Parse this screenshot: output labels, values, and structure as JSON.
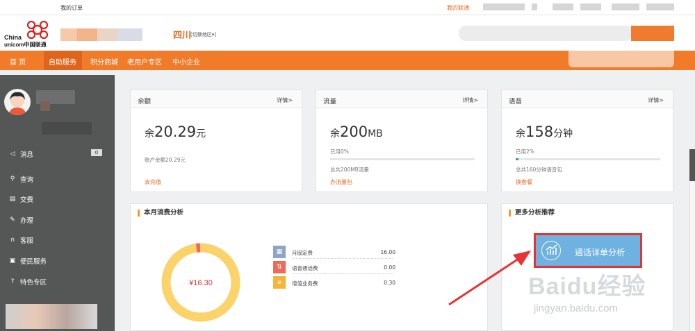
{
  "topbar": {
    "orders": "我的订单",
    "my_unicom": "我的联通"
  },
  "logo": {
    "line1": "China",
    "line2": "unicom中国联通"
  },
  "header": {
    "region": "四川",
    "region_switch": "[切换地区▾]"
  },
  "nav": {
    "items": [
      "首 页",
      "自助服务",
      "积分商城",
      "老用户专区",
      "中小企业"
    ]
  },
  "sidebar": {
    "message_label": "消息",
    "message_count": "0",
    "items": [
      "查询",
      "交费",
      "办理",
      "客服",
      "便民服务",
      "特色专区"
    ]
  },
  "balance": {
    "title": "余额",
    "more": "详情>",
    "prefix": "余",
    "value": "20.29",
    "unit": "元",
    "detail": "账户余额20.29元",
    "action": "去充值"
  },
  "traffic": {
    "title": "流量",
    "more": "详情>",
    "prefix": "余",
    "value": "200",
    "unit": "MB",
    "used": "已用0%",
    "used_fraction": 0.0,
    "detail": "总共200MB流量",
    "action": "办流量包"
  },
  "voice": {
    "title": "语音",
    "more": "详情>",
    "prefix": "余",
    "value": "158",
    "unit": "分钟",
    "used": "已用2%",
    "used_fraction": 0.02,
    "detail": "总共160分钟语音包",
    "action": "换套餐"
  },
  "consumption": {
    "title": "本月消费分析",
    "total": "¥16.30",
    "items": [
      {
        "name": "月固定费",
        "value": "16.00",
        "color": "#8ea6c6",
        "icon": "calendar-icon"
      },
      {
        "name": "语音通话费",
        "value": "0.00",
        "color": "#ee6a5a",
        "icon": "call-icon"
      },
      {
        "name": "增值业务费",
        "value": "0.30",
        "color": "#f5b43a",
        "icon": "clip-icon"
      }
    ]
  },
  "analysis": {
    "title": "更多分析推荐",
    "button": "通话详单分析"
  },
  "watermark": {
    "brand": "Baidu经验",
    "url": "jingyan.baidu.com"
  }
}
